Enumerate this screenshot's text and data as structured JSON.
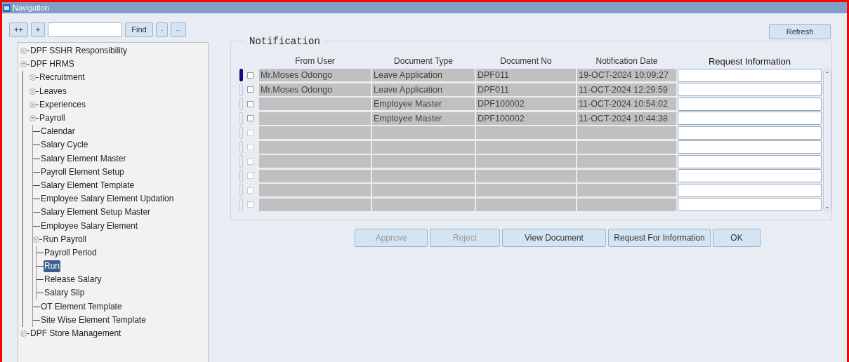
{
  "window": {
    "title": "Navigation"
  },
  "toolbar": {
    "buttons": [
      {
        "label": "++"
      },
      {
        "label": "+"
      }
    ],
    "find": "Find",
    "collapse_buttons": [
      {
        "label": "-"
      },
      {
        "label": "--"
      }
    ]
  },
  "tree": [
    {
      "label": "DPF SSHR Responsibility",
      "expanded": false,
      "selected": false
    },
    {
      "label": "DPF HRMS",
      "expanded": true,
      "selected": false,
      "children": [
        {
          "label": "Recruitment",
          "expanded": false,
          "selected": false
        },
        {
          "label": "Leaves",
          "expanded": false,
          "selected": false
        },
        {
          "label": "Experiences",
          "expanded": false,
          "selected": false
        },
        {
          "label": "Payroll",
          "expanded": true,
          "selected": false,
          "children": [
            {
              "label": "Calendar",
              "selected": false
            },
            {
              "label": "Salary Cycle",
              "selected": false
            },
            {
              "label": "Salary Element Master",
              "selected": false
            },
            {
              "label": "Payroll Element Setup",
              "selected": false
            },
            {
              "label": "Salary Element Template",
              "selected": false
            },
            {
              "label": "Employee Salary Element Updation",
              "selected": false
            },
            {
              "label": "Salary Element Setup Master",
              "selected": false
            },
            {
              "label": "Employee Salary Element",
              "selected": false
            },
            {
              "label": "Run Payroll",
              "expanded": true,
              "selected": false,
              "children": [
                {
                  "label": "Payroll Period",
                  "selected": false
                },
                {
                  "label": "Run",
                  "selected": true
                },
                {
                  "label": "Release Salary",
                  "selected": false
                },
                {
                  "label": "Salary Slip",
                  "selected": false
                }
              ]
            },
            {
              "label": "OT Element Template",
              "selected": false
            },
            {
              "label": "Site Wise Element Template",
              "selected": false
            }
          ]
        }
      ]
    },
    {
      "label": "DPF Store Management",
      "expanded": false,
      "selected": false
    }
  ],
  "refresh": "Refresh",
  "notification": {
    "title": "Notification",
    "columns": [
      "From User",
      "Document Type",
      "Document No",
      "Notification Date",
      "Request Information"
    ],
    "rows": [
      {
        "selected": true,
        "checked": false,
        "disabled": false,
        "from_user": "Mr.Moses Odongo",
        "document_type": "Leave Application",
        "document_no": "DPF011",
        "date": "19-OCT-2024 10:09:27"
      },
      {
        "selected": false,
        "checked": false,
        "disabled": false,
        "from_user": "Mr.Moses Odongo",
        "document_type": "Leave Application",
        "document_no": "DPF011",
        "date": "11-OCT-2024 12:29:59"
      },
      {
        "selected": false,
        "checked": false,
        "disabled": false,
        "document_type": "Employee Master",
        "document_no": "DPF100002",
        "date": "11-OCT-2024 10:54:02"
      },
      {
        "selected": false,
        "checked": false,
        "disabled": false,
        "document_type": "Employee Master",
        "document_no": "DPF100002",
        "date": "11-OCT-2024 10:44:38"
      },
      {
        "selected": false,
        "checked": false,
        "disabled": true
      },
      {
        "selected": false,
        "checked": false,
        "disabled": true
      },
      {
        "selected": false,
        "checked": false,
        "disabled": true
      },
      {
        "selected": false,
        "checked": false,
        "disabled": true
      },
      {
        "selected": false,
        "checked": false,
        "disabled": true
      },
      {
        "selected": false,
        "checked": false,
        "disabled": true
      }
    ]
  },
  "actions": [
    {
      "label": "Approve",
      "disabled": true
    },
    {
      "label": "Reject",
      "disabled": true
    },
    {
      "label": "View Document",
      "disabled": false
    },
    {
      "label": "Request For Information",
      "disabled": false
    },
    {
      "label": "OK",
      "disabled": false
    }
  ]
}
